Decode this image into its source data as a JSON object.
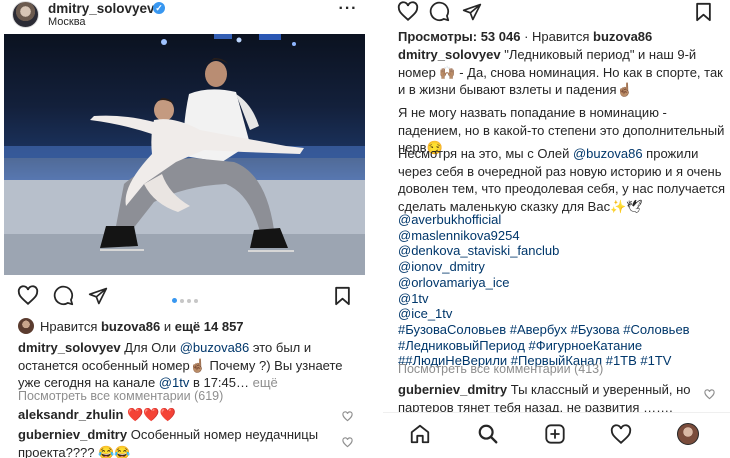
{
  "left_post": {
    "header": {
      "username": "dmitry_solovyev",
      "location": "Москва",
      "more_icon": "more-dots-icon"
    },
    "carousel": {
      "total": 4,
      "active": 1
    },
    "likes": {
      "prefix": "Нравится ",
      "user": "buzova86",
      "middle": " и ",
      "others": "ещё 14 857"
    },
    "caption": {
      "user": "dmitry_solovyev",
      "text1": " Для Оли ",
      "tag1": "@buzova86",
      "text2": " это был и останется особенный номер☝🏽 Почему ?) Вы узнаете уже сегодня на канале ",
      "tag2": "@1tv",
      "text3": " в 17:45…",
      "more": " ещё"
    },
    "view_all_comments": "Посмотреть все комментарии (619)",
    "comments": [
      {
        "user": "aleksandr_zhulin",
        "text": " ❤️❤️❤️"
      },
      {
        "user": "guberniev_dmitry",
        "text": " Особенный номер неудачницы проекта???? 😂😂"
      }
    ]
  },
  "right_post": {
    "views": {
      "label": "Просмотры: ",
      "count": "53 046",
      "sep": " · ",
      "liked_prefix": "Нравится ",
      "liked_user": "buzova86"
    },
    "caption_user": "dmitry_solovyev",
    "paragraph1": " \"Ледниковый период\" и наш 9-й номер 🙌🏽 - Да, снова номинация. Но как в спорте, так и в жизни бывают взлеты и падения☝🏽",
    "paragraph2": "Я не могу назвать попадание в номинацию - падением, но в какой-то степени это дополнительный нерв😏",
    "paragraph3_a": "Несмотря на это, мы с Олей ",
    "paragraph3_tag": "@buzova86",
    "paragraph3_b": " прожили через себя в очередной раз новую историю и я очень доволен тем, что преодолевая себя, у нас получается сделать маленькую сказку для Вас✨🕊",
    "tags": [
      "@averbukhofficial",
      "@maslennikova9254",
      "@denkova_staviski_fanclub",
      "@ionov_dmitry",
      "@orlovamariya_ice",
      "@1tv",
      "@ice_1tv",
      "#БузоваСоловьев #Авербух #Бузова #Соловьев",
      "#ЛедниковыйПериод #ФигурноеКатание",
      "##ЛюдиНеВерили #ПервыйКанал #1ТВ #1TV"
    ],
    "view_all_comments": "Посмотреть все комментарии (413)",
    "comment": {
      "user": "guberniev_dmitry",
      "text": " Ты классный и уверенный, но партеров тянет тебя назад, не развития ……."
    },
    "bottom_nav": [
      "home-icon",
      "search-icon",
      "new-post-icon",
      "activity-heart-icon",
      "profile-avatar"
    ]
  }
}
